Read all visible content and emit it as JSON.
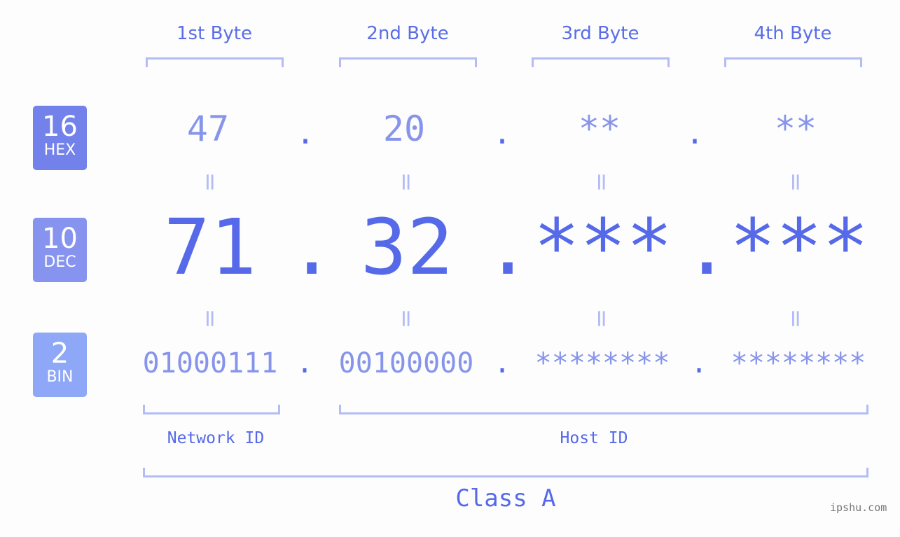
{
  "header": {
    "bytes": [
      "1st Byte",
      "2nd Byte",
      "3rd Byte",
      "4th Byte"
    ]
  },
  "rows": {
    "hex": {
      "base": "16",
      "label": "HEX",
      "values": [
        "47",
        "20",
        "**",
        "**"
      ],
      "color": "#7381ea"
    },
    "dec": {
      "base": "10",
      "label": "DEC",
      "values": [
        "71",
        "32",
        "***",
        "***"
      ],
      "color": "#8794ef"
    },
    "bin": {
      "base": "2",
      "label": "BIN",
      "values": [
        "01000111",
        "00100000",
        "********",
        "********"
      ],
      "color": "#8ea7f6"
    }
  },
  "separator": ".",
  "equals": "=",
  "network_label": "Network ID",
  "host_label": "Host ID",
  "class_label": "Class A",
  "brand": "ipshu.com",
  "colors": {
    "accent": "#5669e9",
    "muted": "#8794ec",
    "bracket": "#b3bcf7"
  }
}
